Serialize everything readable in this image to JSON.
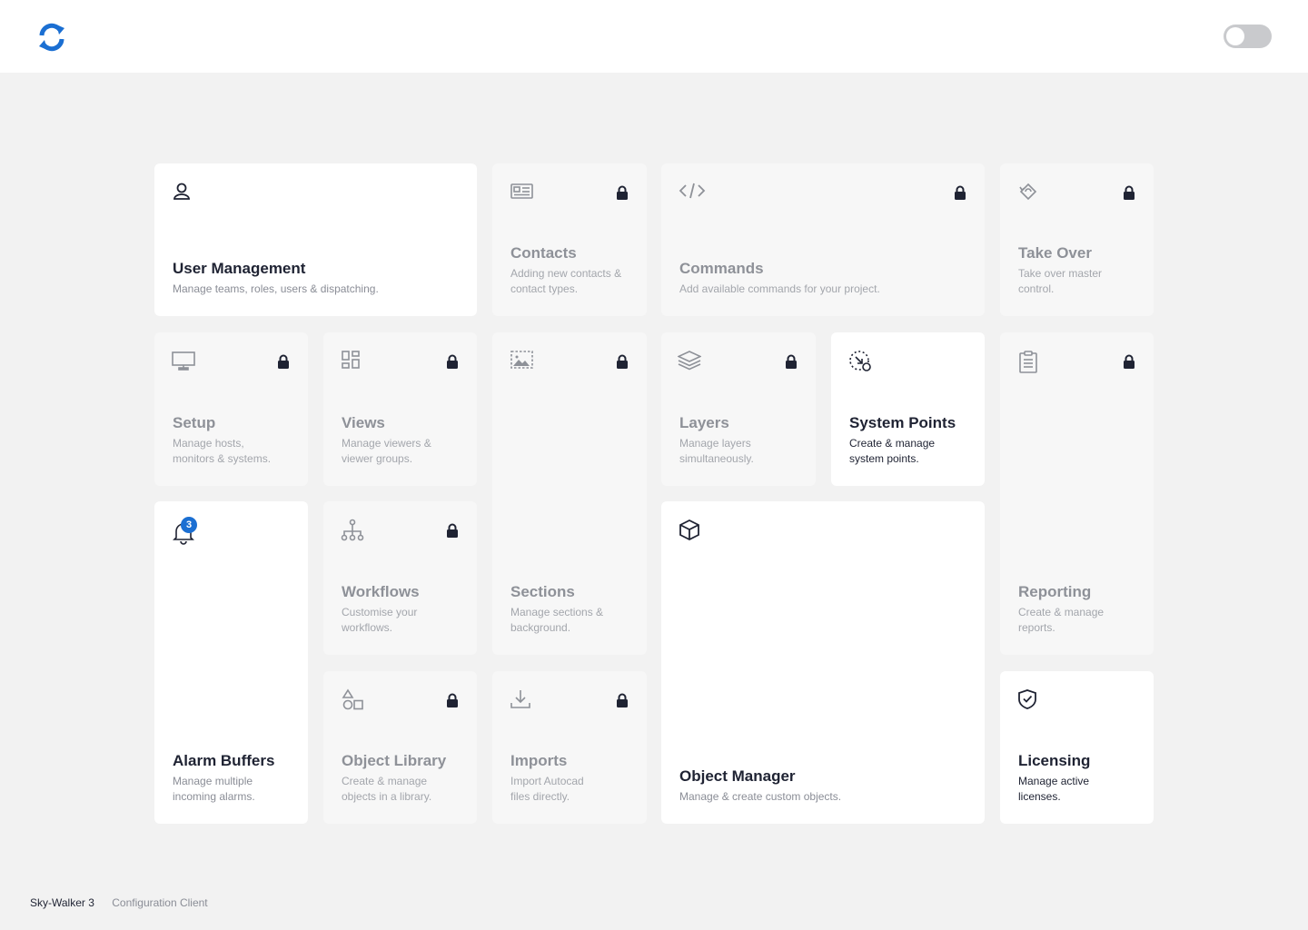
{
  "header": {
    "logo_icon": "refresh-logo-icon",
    "toggle_state": "off",
    "accent_color": "#1b6fd2"
  },
  "tiles": {
    "user_management": {
      "title": "User Management",
      "desc": "Manage teams, roles, users & dispatching.",
      "icon": "user-icon",
      "locked": false
    },
    "contacts": {
      "title": "Contacts",
      "desc": "Adding new contacts & contact types.",
      "icon": "contact-card-icon",
      "locked": true
    },
    "commands": {
      "title": "Commands",
      "desc": "Add available commands for your project.",
      "icon": "code-icon",
      "locked": true
    },
    "take_over": {
      "title": "Take Over",
      "desc": "Take over master control.",
      "icon": "rotate-diamond-icon",
      "locked": true
    },
    "setup": {
      "title": "Setup",
      "desc": "Manage hosts, monitors & systems.",
      "icon": "monitor-icon",
      "locked": true
    },
    "views": {
      "title": "Views",
      "desc": "Manage viewers & viewer groups.",
      "icon": "grid-icon",
      "locked": true
    },
    "sections": {
      "title": "Sections",
      "desc": "Manage sections & background.",
      "icon": "image-selection-icon",
      "locked": true
    },
    "layers": {
      "title": "Layers",
      "desc": "Manage layers simultaneously.",
      "icon": "layers-icon",
      "locked": true
    },
    "system_points": {
      "title": "System Points",
      "desc": "Create & manage system points.",
      "icon": "system-point-icon",
      "locked": false
    },
    "reporting": {
      "title": "Reporting",
      "desc": "Create & manage reports.",
      "icon": "document-icon",
      "locked": true
    },
    "alarm_buffers": {
      "title": "Alarm Buffers",
      "desc": "Manage multiple incoming alarms.",
      "icon": "bell-icon",
      "locked": false,
      "badge": "3"
    },
    "workflows": {
      "title": "Workflows",
      "desc": "Customise your workflows.",
      "icon": "hierarchy-icon",
      "locked": true
    },
    "object_manager": {
      "title": "Object Manager",
      "desc": "Manage & create custom objects.",
      "icon": "cube-icon",
      "locked": false
    },
    "object_library": {
      "title": "Object Library",
      "desc": "Create & manage objects in a library.",
      "icon": "shapes-icon",
      "locked": true
    },
    "imports": {
      "title": "Imports",
      "desc": "Import Autocad files directly.",
      "icon": "download-icon",
      "locked": true
    },
    "licensing": {
      "title": "Licensing",
      "desc": "Manage active licenses.",
      "icon": "shield-check-icon",
      "locked": false
    }
  },
  "footer": {
    "app_name": "Sky-Walker 3",
    "subtitle": "Configuration Client"
  }
}
